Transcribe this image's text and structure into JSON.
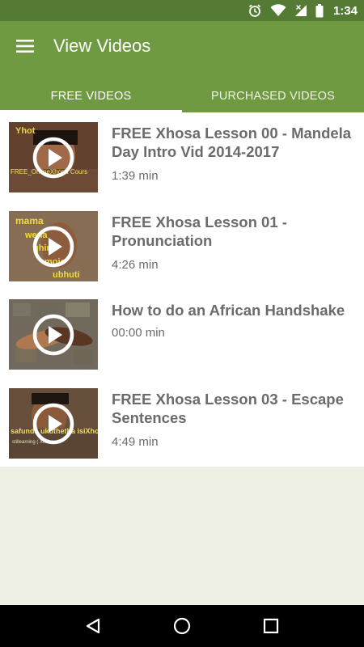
{
  "status_bar": {
    "time": "1:34",
    "icons": [
      "alarm-icon",
      "wifi-icon",
      "signal-icon",
      "battery-icon"
    ],
    "background": "#557a34"
  },
  "app_bar": {
    "title": "View Videos",
    "background": "#6f9a42",
    "menu_icon": "hamburger-menu-icon"
  },
  "tabs": [
    {
      "label": "FREE VIDEOS",
      "selected": true
    },
    {
      "label": "PURCHASED VIDEOS",
      "selected": false
    }
  ],
  "videos": [
    {
      "title": "FREE Xhosa Lesson 00 - Mandela Day Intro Vid 2014-2017",
      "duration": "1:39 min",
      "thumbnail_text": "Yhot / FREE Online Xhosa Course"
    },
    {
      "title": "FREE Xhosa Lesson 01 - Pronunciation",
      "duration": "4:26 min",
      "thumbnail_text": "mama wena qhira mojo ubhuti"
    },
    {
      "title": "How to do an African Handshake",
      "duration": "00:00 min",
      "thumbnail_text": ""
    },
    {
      "title": "FREE Xhosa Lesson 03 - Escape Sentences",
      "duration": "4:49 min",
      "thumbnail_text": "safunda kathetha isiXhosa"
    }
  ],
  "nav_bar": {
    "buttons": [
      "back-icon",
      "home-icon",
      "recents-icon"
    ]
  }
}
